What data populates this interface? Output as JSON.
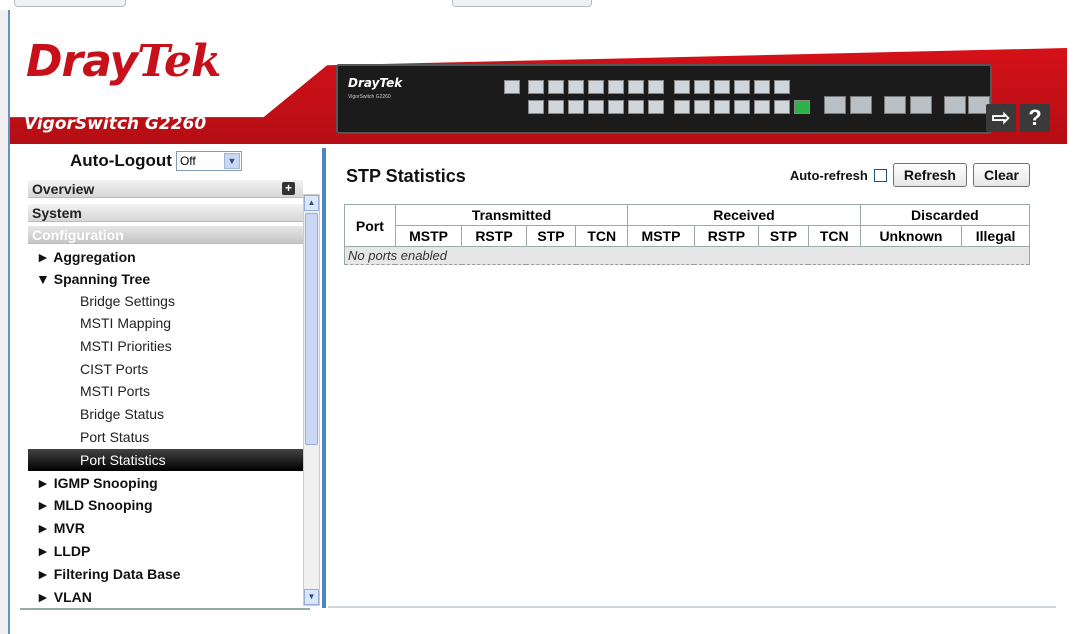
{
  "header": {
    "logo_dray": "Dray",
    "logo_tek": "Tek",
    "model": "VigorSwitch G2260",
    "device_logo": "DrayTek",
    "device_sub": "VigorSwitch G2260",
    "logout_icon": "logout-arrow-icon",
    "help_label": "?"
  },
  "sidebar": {
    "autologout_label": "Auto-Logout",
    "autologout_value": "Off",
    "overview": "Overview",
    "system": "System",
    "configuration": "Configuration",
    "items": [
      {
        "label": "► Aggregation"
      },
      {
        "label": "▼ Spanning Tree"
      },
      {
        "label": "Bridge Settings"
      },
      {
        "label": "MSTI Mapping"
      },
      {
        "label": "MSTI Priorities"
      },
      {
        "label": "CIST Ports"
      },
      {
        "label": "MSTI Ports"
      },
      {
        "label": "Bridge Status"
      },
      {
        "label": "Port Status"
      },
      {
        "label": "Port Statistics"
      },
      {
        "label": "► IGMP Snooping"
      },
      {
        "label": "► MLD Snooping"
      },
      {
        "label": "► MVR"
      },
      {
        "label": "► LLDP"
      },
      {
        "label": "► Filtering Data Base"
      },
      {
        "label": "► VLAN"
      }
    ]
  },
  "main": {
    "title": "STP Statistics",
    "autorefresh_label": "Auto-refresh",
    "refresh_label": "Refresh",
    "clear_label": "Clear",
    "table": {
      "port_header": "Port",
      "groups": [
        "Transmitted",
        "Received",
        "Discarded"
      ],
      "columns": [
        "MSTP",
        "RSTP",
        "STP",
        "TCN",
        "MSTP",
        "RSTP",
        "STP",
        "TCN",
        "Unknown",
        "Illegal"
      ],
      "empty_message": "No ports enabled"
    }
  },
  "colors": {
    "brand_red": "#c8101a",
    "active_menu": "#000000",
    "divider_blue": "#4a86c8"
  }
}
